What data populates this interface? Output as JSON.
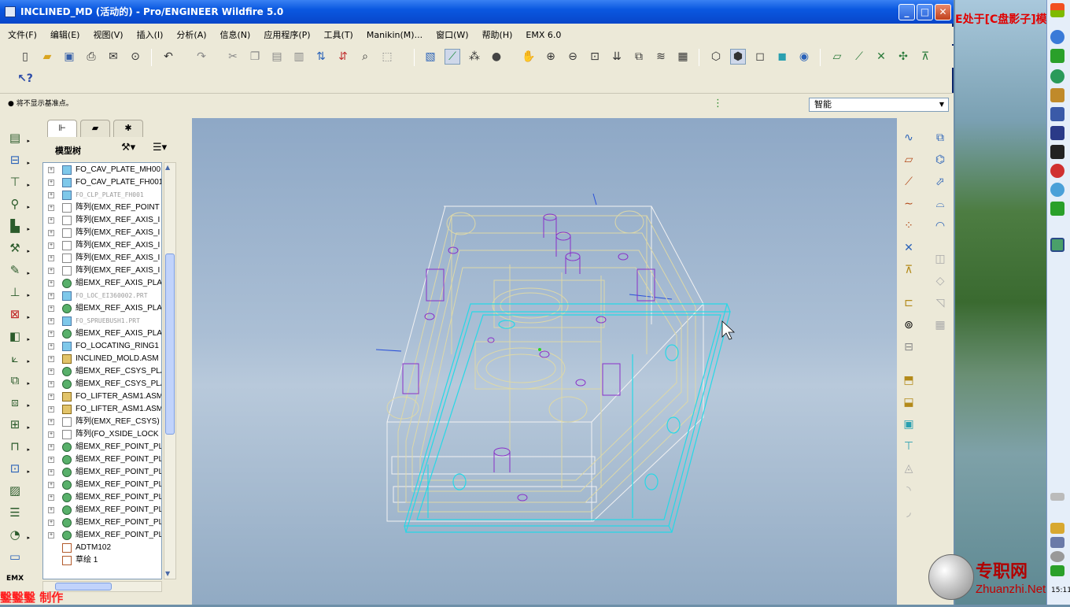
{
  "window": {
    "title": "INCLINED_MD (活动的) - Pro/ENGINEER Wildfire 5.0"
  },
  "menu": [
    "文件(F)",
    "编辑(E)",
    "视图(V)",
    "插入(I)",
    "分析(A)",
    "信息(N)",
    "应用程序(P)",
    "工具(T)",
    "Manikin(M)...",
    "窗口(W)",
    "帮助(H)",
    "EMX 6.0"
  ],
  "status": {
    "message": "● 将不显示基准点。",
    "filter": "智能"
  },
  "tree": {
    "tab_title": "模型树",
    "items": [
      {
        "label": "FO_CAV_PLATE_MH00",
        "kind": "part"
      },
      {
        "label": "FO_CAV_PLATE_FH001",
        "kind": "part"
      },
      {
        "label": "FO_CLP_PLATE_FH001",
        "kind": "dim"
      },
      {
        "label": "阵列(EMX_REF_POINT",
        "kind": "pat"
      },
      {
        "label": "阵列(EMX_REF_AXIS_I",
        "kind": "pat"
      },
      {
        "label": "阵列(EMX_REF_AXIS_I",
        "kind": "pat"
      },
      {
        "label": "阵列(EMX_REF_AXIS_I",
        "kind": "pat"
      },
      {
        "label": "阵列(EMX_REF_AXIS_I",
        "kind": "pat"
      },
      {
        "label": "阵列(EMX_REF_AXIS_I",
        "kind": "pat"
      },
      {
        "label": "組EMX_REF_AXIS_PLA",
        "kind": "grp"
      },
      {
        "label": "FO_LOC_EI360002.PRT",
        "kind": "dim"
      },
      {
        "label": "組EMX_REF_AXIS_PLA",
        "kind": "grp"
      },
      {
        "label": "FO_SPRUEBUSH1.PRT",
        "kind": "dim"
      },
      {
        "label": "組EMX_REF_AXIS_PLA",
        "kind": "grp"
      },
      {
        "label": "FO_LOCATING_RING1",
        "kind": "part"
      },
      {
        "label": "INCLINED_MOLD.ASM",
        "kind": "asm"
      },
      {
        "label": "組EMX_REF_CSYS_PLA",
        "kind": "grp"
      },
      {
        "label": "組EMX_REF_CSYS_PLA",
        "kind": "grp"
      },
      {
        "label": "FO_LIFTER_ASM1.ASM",
        "kind": "asm"
      },
      {
        "label": "FO_LIFTER_ASM1.ASM",
        "kind": "asm"
      },
      {
        "label": "阵列(EMX_REF_CSYS)",
        "kind": "pat"
      },
      {
        "label": "阵列(FO_XSIDE_LOCK",
        "kind": "pat"
      },
      {
        "label": "組EMX_REF_POINT_PL",
        "kind": "grp"
      },
      {
        "label": "組EMX_REF_POINT_PL",
        "kind": "grp"
      },
      {
        "label": "組EMX_REF_POINT_PL",
        "kind": "grp"
      },
      {
        "label": "組EMX_REF_POINT_PL",
        "kind": "grp"
      },
      {
        "label": "組EMX_REF_POINT_PL",
        "kind": "grp"
      },
      {
        "label": "組EMX_REF_POINT_PL",
        "kind": "grp"
      },
      {
        "label": "組EMX_REF_POINT_PL",
        "kind": "grp"
      },
      {
        "label": "組EMX_REF_POINT_PL",
        "kind": "grp"
      },
      {
        "label": "ADTM102",
        "kind": "dtm"
      },
      {
        "label": "草绘 1",
        "kind": "sketch"
      }
    ]
  },
  "desktop": {
    "overlay_text": "E处于[C盘影子]模",
    "watermark_cn": "专职网",
    "watermark_en": "Zhuanzhi.Net",
    "clock": "15:11",
    "maker_text": "鑿鑿鑿 制作"
  },
  "colors": {
    "wire_yellow": "#ddd8a8",
    "wire_white": "#f2f2f2",
    "wire_cyan": "#26d8e6",
    "wire_purple": "#8a30c8",
    "titlebar": "#0a58e0"
  }
}
